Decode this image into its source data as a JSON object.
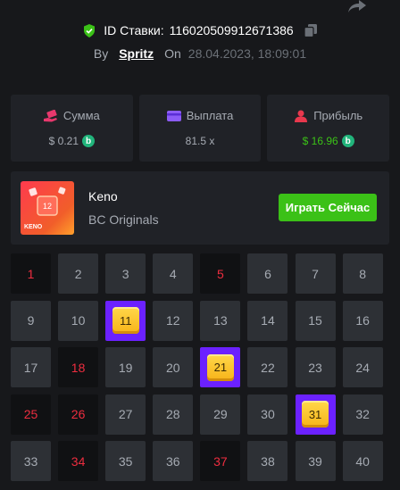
{
  "header": {
    "bet_id_label": "ID Ставки:",
    "bet_id": "116020509912671386",
    "by_label": "By",
    "username": "Spritz",
    "on_label": "On",
    "date": "28.04.2023, 18:09:01"
  },
  "stats": {
    "amount": {
      "label": "Сумма",
      "value": "$ 0.21",
      "icon": "money-hand-icon"
    },
    "payout": {
      "label": "Выплата",
      "value": "81.5 x",
      "icon": "wallet-icon"
    },
    "profit": {
      "label": "Прибыль",
      "value": "$ 16.96",
      "icon": "user-coin-icon"
    }
  },
  "game": {
    "name": "Keno",
    "provider": "BC Originals",
    "play_label": "Играть Сейчас",
    "thumb_logo": "KENO",
    "thumb_number": "12"
  },
  "grid": {
    "numbers": [
      1,
      2,
      3,
      4,
      5,
      6,
      7,
      8,
      9,
      10,
      11,
      12,
      13,
      14,
      15,
      16,
      17,
      18,
      19,
      20,
      21,
      22,
      23,
      24,
      25,
      26,
      27,
      28,
      29,
      30,
      31,
      32,
      33,
      34,
      35,
      36,
      37,
      38,
      39,
      40
    ],
    "drawn": [
      1,
      5,
      18,
      25,
      26,
      34,
      37
    ],
    "hits": [
      11,
      21,
      31
    ]
  },
  "colors": {
    "accent_green": "#3bc117",
    "drawn_red": "#ed2d3f",
    "hit_purple": "#6b21ff",
    "coin_green": "#21b47b"
  }
}
